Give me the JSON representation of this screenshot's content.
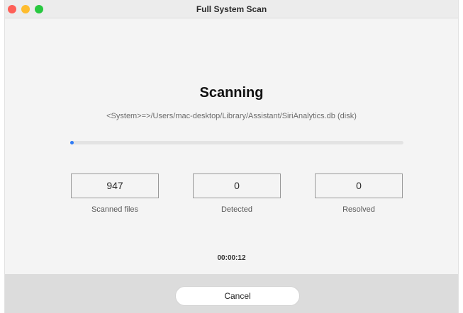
{
  "window": {
    "title": "Full System Scan"
  },
  "traffic_lights": {
    "close_color": "#fe5f57",
    "minimize_color": "#febc2e",
    "zoom_color": "#28c840"
  },
  "scan": {
    "heading": "Scanning",
    "current_path": "<System>=>/Users/mac-desktop/Library/Assistant/SiriAnalytics.db (disk)",
    "progress_fraction": 0.01,
    "progress_color": "#2f7cf6",
    "elapsed": "00:00:12"
  },
  "stats": [
    {
      "value": "947",
      "label": "Scanned files"
    },
    {
      "value": "0",
      "label": "Detected"
    },
    {
      "value": "0",
      "label": "Resolved"
    }
  ],
  "footer": {
    "cancel_label": "Cancel"
  }
}
